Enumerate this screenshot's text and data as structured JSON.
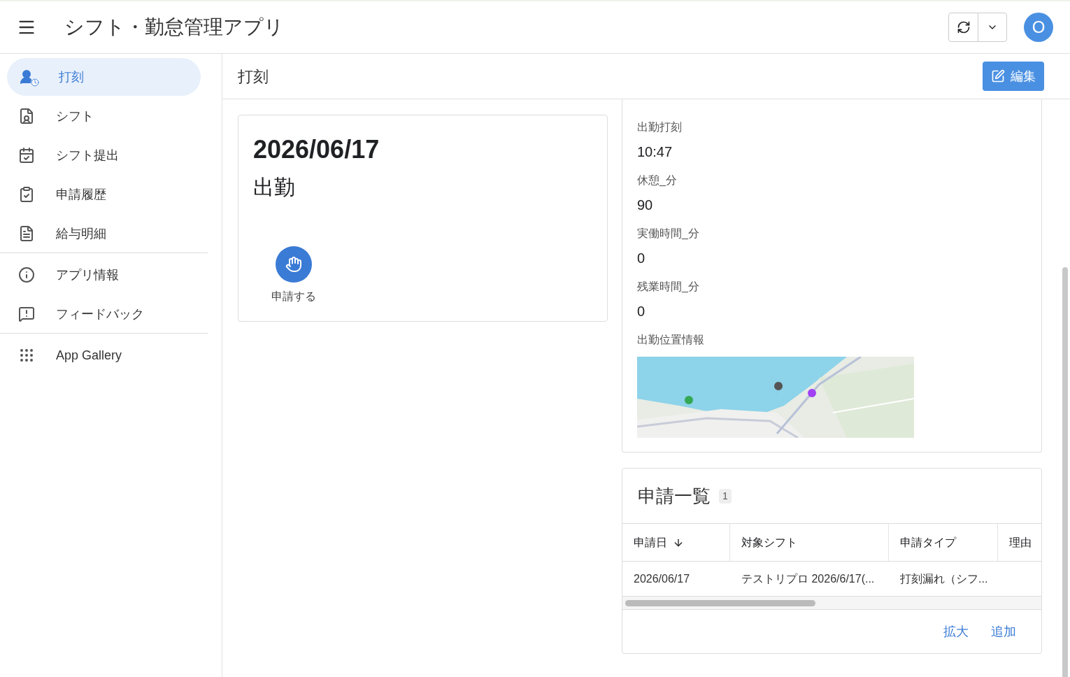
{
  "app_bar": {
    "title": "シフト・勤怠管理アプリ",
    "avatar": "O"
  },
  "sidebar": {
    "groups": [
      [
        {
          "label": "打刻",
          "selected": true
        },
        {
          "label": "シフト",
          "selected": false
        },
        {
          "label": "シフト提出",
          "selected": false
        },
        {
          "label": "申請履歴",
          "selected": false
        },
        {
          "label": "給与明細",
          "selected": false
        }
      ],
      [
        {
          "label": "アプリ情報",
          "selected": false
        },
        {
          "label": "フィードバック",
          "selected": false
        }
      ],
      [
        {
          "label": "App Gallery",
          "selected": false
        }
      ]
    ]
  },
  "page": {
    "title": "打刻",
    "edit_button": "編集"
  },
  "summary_card": {
    "date": "2026/06/17",
    "status": "出勤",
    "action": "申請する"
  },
  "detail_card": {
    "fields": [
      {
        "label": "出勤打刻",
        "value": "10:47"
      },
      {
        "label": "休憩_分",
        "value": "90"
      },
      {
        "label": "実働時間_分",
        "value": "0"
      },
      {
        "label": "残業時間_分",
        "value": "0"
      }
    ],
    "map_label": "出勤位置情報"
  },
  "requests": {
    "title": "申請一覧",
    "count": "1",
    "columns": [
      "申請日",
      "対象シフト",
      "申請タイプ",
      "理由"
    ],
    "rows": [
      [
        "2026/06/17",
        "テストリプロ 2026/6/17(...",
        "打刻漏れ（シフ..."
      ]
    ],
    "actions": [
      "拡大",
      "追加"
    ]
  }
}
